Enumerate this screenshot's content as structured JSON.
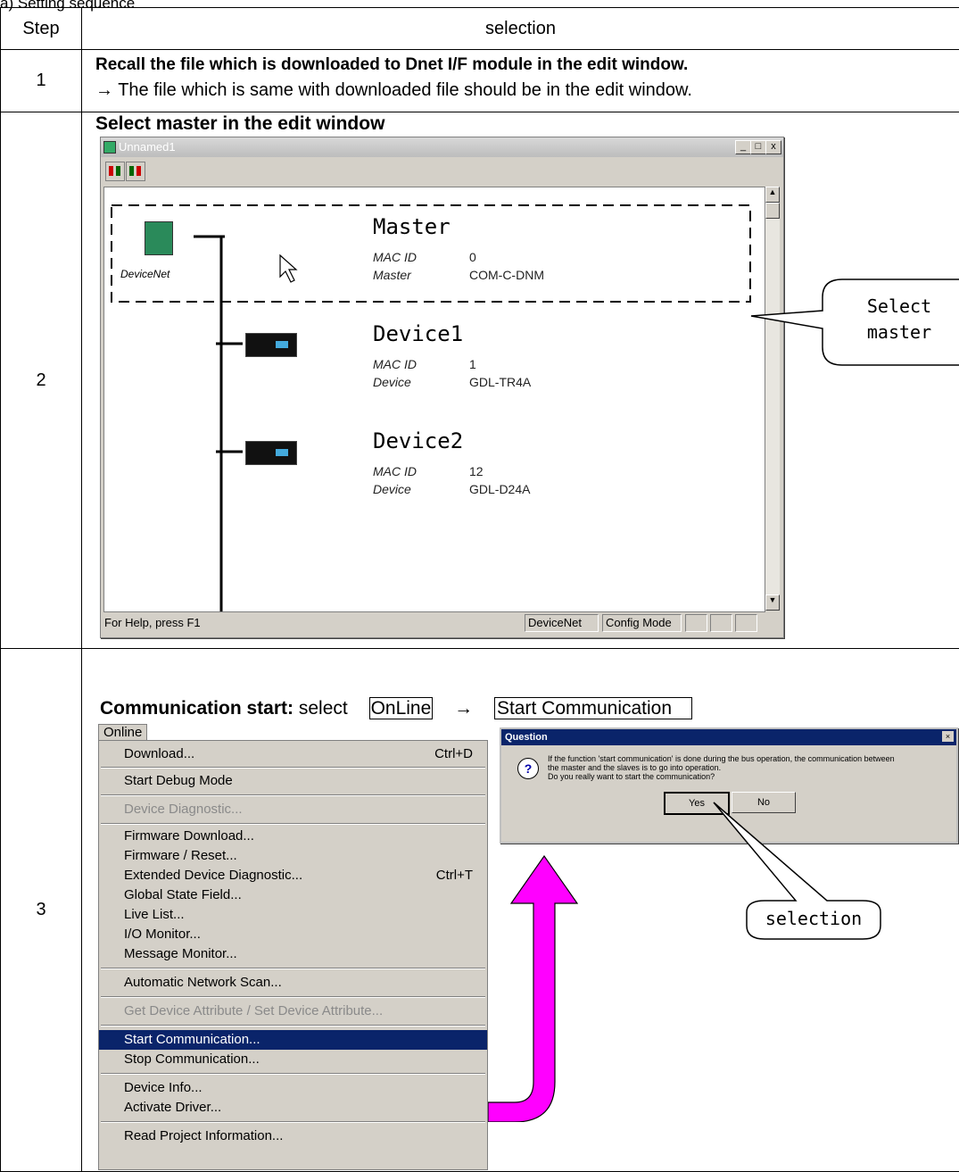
{
  "caption": "a) Setting sequence",
  "table": {
    "header_step": "Step",
    "header_selection": "selection",
    "rows": [
      {
        "step": "1",
        "line1": "Recall the file which is downloaded to Dnet I/F module in the edit window.",
        "line2": "→ The file which is same with downloaded file should be in the edit window."
      },
      {
        "step": "2",
        "title": "Select master in the edit window"
      },
      {
        "step": "3",
        "title_bold": "Communication start:",
        "title_rest": " select",
        "box1": "OnLine",
        "arrow": "→",
        "box2": "Start Communication"
      }
    ]
  },
  "window": {
    "title": "Unnamed1",
    "controls": [
      "_",
      "□",
      "x"
    ],
    "logo_text": "DeviceNet",
    "nodes": [
      {
        "name": "Master",
        "k1": "MAC ID",
        "v1": "0",
        "k2": "Master",
        "v2": "COM-C-DNM"
      },
      {
        "name": "Device1",
        "k1": "MAC ID",
        "v1": "1",
        "k2": "Device",
        "v2": "GDL-TR4A"
      },
      {
        "name": "Device2",
        "k1": "MAC ID",
        "v1": "12",
        "k2": "Device",
        "v2": "GDL-D24A"
      }
    ],
    "status_help": "For Help, press F1",
    "status_net": "DeviceNet",
    "status_mode": "Config Mode"
  },
  "callout_master": [
    "Select",
    "master"
  ],
  "menu": {
    "title": "Online",
    "items": [
      {
        "label": "Download...",
        "shortcut": "Ctrl+D"
      },
      {
        "label": "Start Debug Mode"
      },
      {
        "label": "Device Diagnostic..."
      },
      {
        "label": "Firmware Download..."
      },
      {
        "label": "Firmware / Reset..."
      },
      {
        "label": "Extended Device Diagnostic...",
        "shortcut": "Ctrl+T"
      },
      {
        "label": "Global State Field..."
      },
      {
        "label": "Live List..."
      },
      {
        "label": "I/O Monitor..."
      },
      {
        "label": "Message Monitor..."
      },
      {
        "label": "Automatic Network Scan..."
      },
      {
        "label": "Get Device Attribute / Set Device Attribute..."
      },
      {
        "label": "Start Communication..."
      },
      {
        "label": "Stop Communication..."
      },
      {
        "label": "Device Info..."
      },
      {
        "label": "Activate Driver..."
      },
      {
        "label": "Read Project Information..."
      }
    ]
  },
  "dialog": {
    "title": "Question",
    "line1": "If the function 'start communication' is done during the bus operation, the communication between",
    "line2": "the master and the slaves is to go into operation.",
    "line3": "Do you really want to start the communication?",
    "yes": "Yes",
    "no": "No"
  },
  "callout_selection": "selection",
  "colors": {
    "highlight": "#0a246a",
    "arrow": "#ff00ff"
  }
}
